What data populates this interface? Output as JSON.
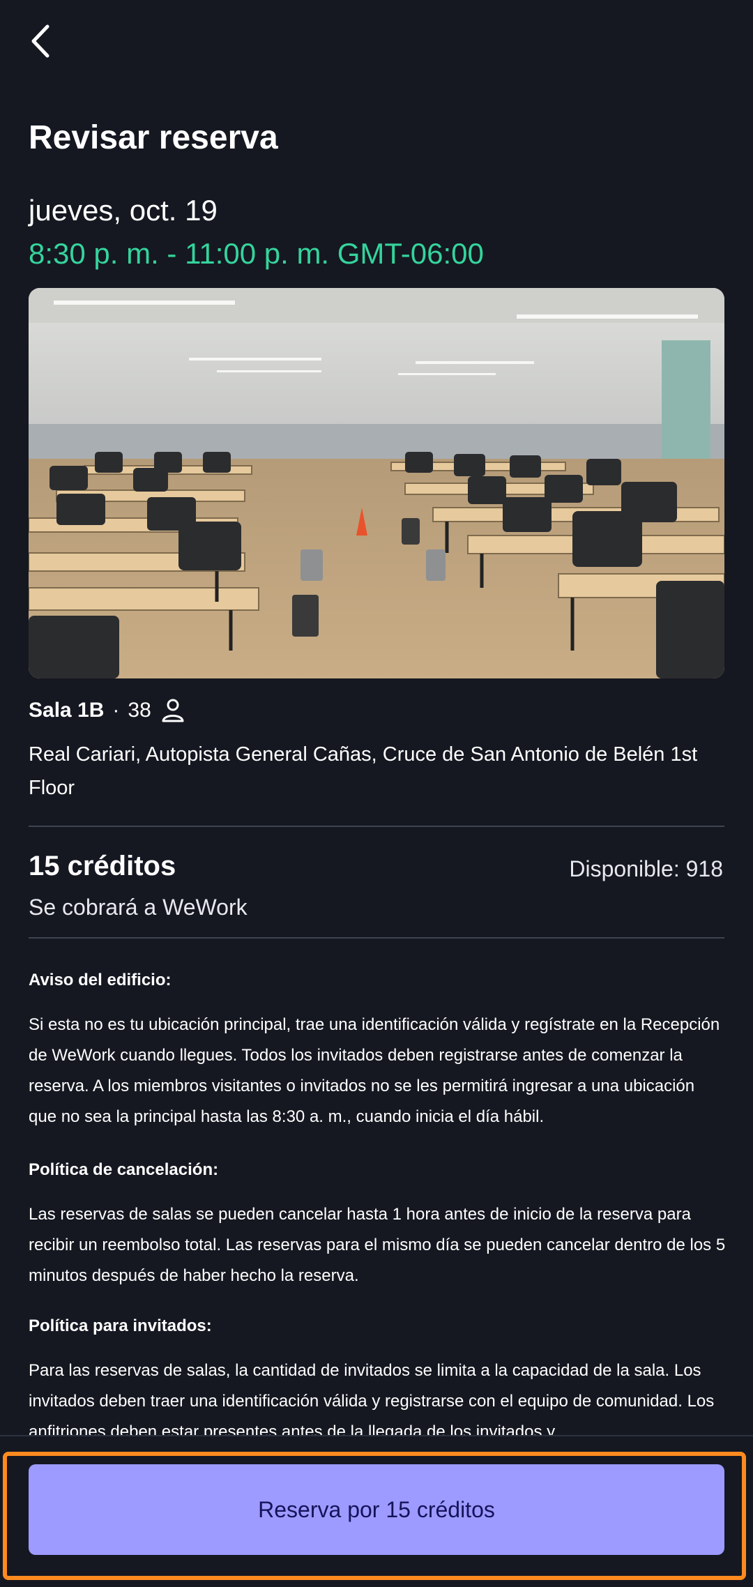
{
  "header": {
    "back_icon": "chevron-left-icon",
    "title": "Revisar reserva"
  },
  "booking": {
    "date": "jueves, oct. 19",
    "time": "8:30 p. m. - 11:00 p. m. GMT-06:00"
  },
  "room": {
    "name": "Sala 1B",
    "separator": "·",
    "capacity": "38",
    "capacity_icon": "person-icon",
    "address": "Real Cariari, Autopista General Cañas, Cruce de San Antonio de Belén 1st Floor"
  },
  "credits": {
    "cost": "15 créditos",
    "available": "Disponible: 918",
    "charged_to": "Se cobrará a WeWork"
  },
  "notices": [
    {
      "title": "Aviso del edificio:",
      "body": "Si esta no es tu ubicación principal, trae una identificación válida y regístrate en la Recepción de WeWork cuando llegues. Todos los invitados deben registrarse antes de comenzar la reserva. A los miembros visitantes o invitados no se les permitirá ingresar a una ubicación que no sea la principal hasta las 8:30 a. m., cuando inicia el día hábil."
    },
    {
      "title": "Política de cancelación:",
      "body": "Las reservas de salas se pueden cancelar hasta 1 hora antes de inicio de la reserva para recibir un reembolso total. Las reservas para el mismo día se pueden cancelar dentro de los 5 minutos después de haber hecho la reserva."
    },
    {
      "title": "Política para invitados:",
      "body": "Para las reservas de salas, la cantidad de invitados se limita a la capacidad de la sala. Los invitados deben traer una identificación válida y registrarse con el equipo de comunidad. Los anfitriones deben estar presentes antes de la llegada de los invitados y"
    }
  ],
  "footer": {
    "book_button": "Reserva por 15 créditos"
  },
  "colors": {
    "background": "#151821",
    "accent_time": "#35d49c",
    "button": "#9d9bff",
    "highlight": "#ff8a1f"
  }
}
